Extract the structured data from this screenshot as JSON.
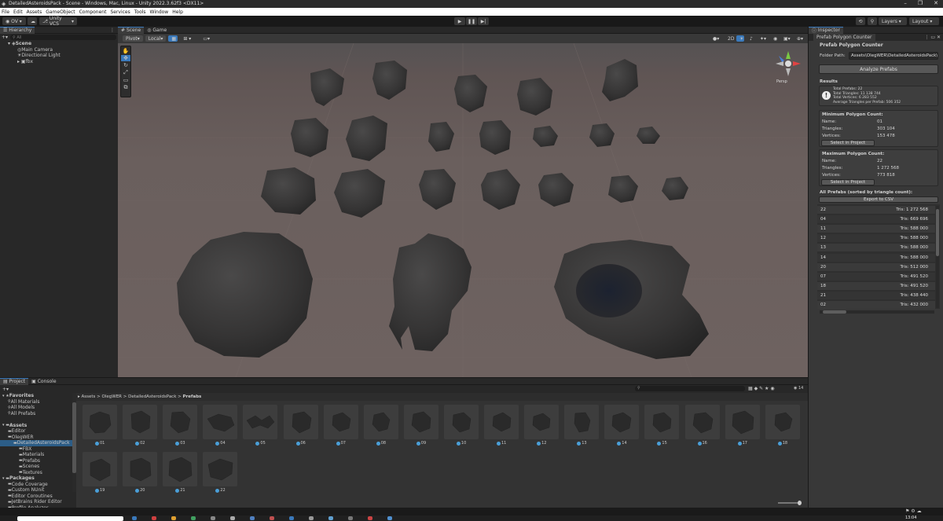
{
  "window": {
    "title": "DetailedAsteroidsPack - Scene - Windows, Mac, Linux - Unity 2022.3.62f3 <DX11>"
  },
  "menu": [
    "File",
    "Edit",
    "Assets",
    "GameObject",
    "Component",
    "Services",
    "Tools",
    "Window",
    "Help"
  ],
  "toolbar": {
    "account": "OV",
    "vcs": "Unity VCS",
    "layers": "Layers",
    "layout": "Layout"
  },
  "hierarchy": {
    "tab": "Hierarchy",
    "search": "All",
    "items": [
      {
        "label": "Scene",
        "level": 0
      },
      {
        "label": "Main Camera",
        "level": 1
      },
      {
        "label": "Directional Light",
        "level": 1
      },
      {
        "label": "fbx",
        "level": 1
      }
    ]
  },
  "scene": {
    "tabs": [
      "Scene",
      "Game"
    ],
    "pivot": "Pivot",
    "local": "Local",
    "mode": "2D",
    "persp": "Persp"
  },
  "inspector": {
    "tab": "Inspector",
    "subtab": "Prefab Polygon Counter",
    "heading": "Prefab Polygon Counter",
    "folder_label": "Folder Path:",
    "folder_value": "Assets\\OlegWER\\DetailedAsteroidsPack\\",
    "analyze": "Analyze Prefabs",
    "results": "Results",
    "info": [
      "Total Prefabs: 22",
      "Total Triangles: 11 138 744",
      "Total Vertices: 6 283 552",
      "Average Triangles per Prefab: 506 352"
    ],
    "min": {
      "title": "Minimum Polygon Count:",
      "name_label": "Name:",
      "name": "01",
      "tri_label": "Triangles:",
      "tri": "303 104",
      "vert_label": "Vertices:",
      "vert": "153 478",
      "button": "Select in Project"
    },
    "max": {
      "title": "Maximum Polygon Count:",
      "name_label": "Name:",
      "name": "22",
      "tri_label": "Triangles:",
      "tri": "1 272 568",
      "vert_label": "Vertices:",
      "vert": "773 818",
      "button": "Select in Project"
    },
    "all_title": "All Prefabs (sorted by triangle count):",
    "export": "Export to CSV",
    "list": [
      {
        "name": "22",
        "tris": "Tris: 1 272 568"
      },
      {
        "name": "04",
        "tris": "Tris: 669 696"
      },
      {
        "name": "11",
        "tris": "Tris: 588 000"
      },
      {
        "name": "12",
        "tris": "Tris: 588 000"
      },
      {
        "name": "13",
        "tris": "Tris: 588 000"
      },
      {
        "name": "14",
        "tris": "Tris: 588 000"
      },
      {
        "name": "20",
        "tris": "Tris: 512 000"
      },
      {
        "name": "07",
        "tris": "Tris: 491 520"
      },
      {
        "name": "18",
        "tris": "Tris: 491 520"
      },
      {
        "name": "21",
        "tris": "Tris: 438 440"
      },
      {
        "name": "02",
        "tris": "Tris: 432 000"
      }
    ]
  },
  "project": {
    "tabs": [
      "Project",
      "Console"
    ],
    "count": "14",
    "breadcrumb": [
      "Assets",
      "OlegWER",
      "DetailedAsteroidsPack",
      "Prefabs"
    ],
    "tree": [
      {
        "label": "Favorites",
        "level": 0,
        "bold": true
      },
      {
        "label": "All Materials",
        "level": 1
      },
      {
        "label": "All Models",
        "level": 1
      },
      {
        "label": "All Prefabs",
        "level": 1
      },
      {
        "label": "",
        "level": 0
      },
      {
        "label": "Assets",
        "level": 0,
        "bold": true
      },
      {
        "label": "Editor",
        "level": 1
      },
      {
        "label": "OlegWER",
        "level": 1
      },
      {
        "label": "DetailedAsteroidsPack",
        "level": 2,
        "sel": true
      },
      {
        "label": "FBX",
        "level": 3
      },
      {
        "label": "Materials",
        "level": 3
      },
      {
        "label": "Prefabs",
        "level": 3
      },
      {
        "label": "Scenes",
        "level": 3
      },
      {
        "label": "Textures",
        "level": 3
      },
      {
        "label": "Packages",
        "level": 0,
        "bold": true
      },
      {
        "label": "Code Coverage",
        "level": 1
      },
      {
        "label": "Custom NUnit",
        "level": 1
      },
      {
        "label": "Editor Coroutines",
        "level": 1
      },
      {
        "label": "JetBrains Rider Editor",
        "level": 1
      },
      {
        "label": "Profile Analyzer",
        "level": 1
      }
    ],
    "assets": [
      "01",
      "02",
      "03",
      "04",
      "05",
      "06",
      "07",
      "08",
      "09",
      "10",
      "11",
      "12",
      "13",
      "14",
      "15",
      "16",
      "17",
      "18",
      "19",
      "20",
      "21",
      "22"
    ]
  },
  "statusbar": {
    "clock": "13:04"
  },
  "colors": {
    "accent": "#3a79bb",
    "panel": "#282828",
    "inspector": "#383838"
  }
}
